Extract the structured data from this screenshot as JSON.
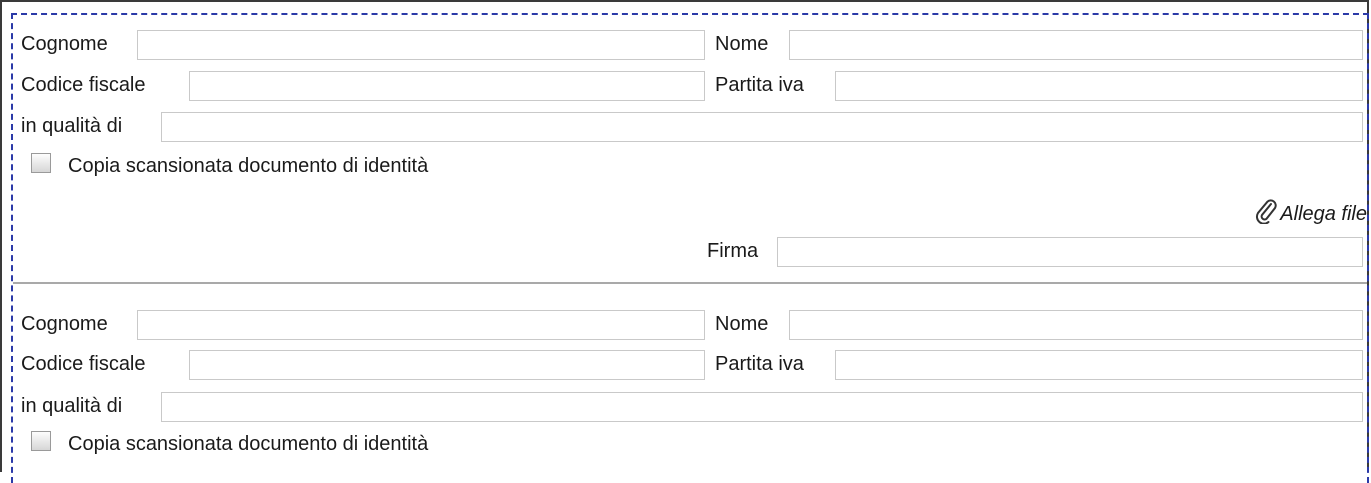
{
  "blocks": [
    {
      "surname_label": "Cognome",
      "name_label": "Nome",
      "tax_code_label": "Codice fiscale",
      "vat_label": "Partita iva",
      "role_label": "in qualità di",
      "id_copy_label": "Copia scansionata documento di identità",
      "attach_label": "Allega file",
      "signature_label": "Firma"
    },
    {
      "surname_label": "Cognome",
      "name_label": "Nome",
      "tax_code_label": "Codice fiscale",
      "vat_label": "Partita iva",
      "role_label": "in qualità di",
      "id_copy_label": "Copia scansionata documento di identità"
    }
  ],
  "icons": {
    "attach": "paperclip-icon"
  }
}
